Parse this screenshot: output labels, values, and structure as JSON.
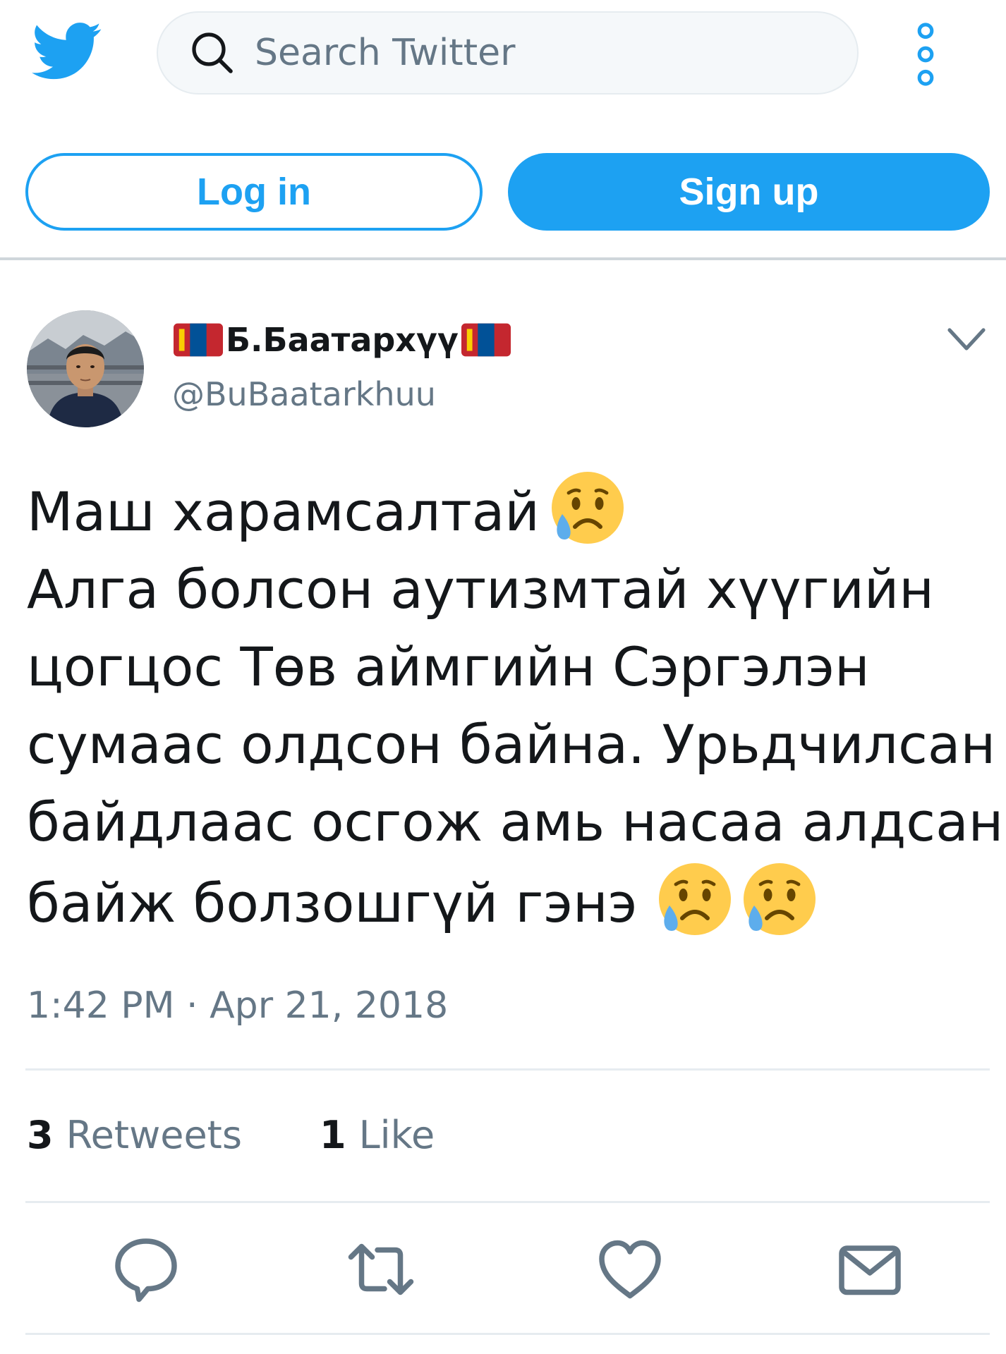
{
  "header": {
    "search_placeholder": "Search Twitter",
    "login_label": "Log in",
    "signup_label": "Sign up"
  },
  "tweet": {
    "display_name": "Б.Баатархүү",
    "handle": "@BuBaatarkhuu",
    "lines": [
      "Маш харамсалтай",
      "Алга болсон аутизмтай хүүгийн",
      "цогцос Төв аймгийн Сэргэлэн",
      "сумаас олдсон байна. Урьдчилсан",
      "байдлаас осгож амь насаа алдсан",
      "байж болзошгүй гэнэ"
    ],
    "timestamp": "1:42 PM · Apr 21, 2018",
    "retweets_count": "3",
    "retweets_label": "Retweets",
    "likes_count": "1",
    "likes_label": "Like"
  },
  "colors": {
    "accent": "#1da1f2",
    "secondary_text": "#657786",
    "primary_text": "#14171a",
    "divider": "#e6ecf0"
  },
  "icons": {
    "logo": "twitter-bird-icon",
    "search": "search-icon",
    "more": "more-vertical-icon",
    "caret": "chevron-down-icon",
    "emoji": "crying-face-emoji",
    "flag": "mongolia-flag-emoji",
    "actions": [
      "reply-icon",
      "retweet-icon",
      "like-icon",
      "direct-message-icon"
    ]
  }
}
